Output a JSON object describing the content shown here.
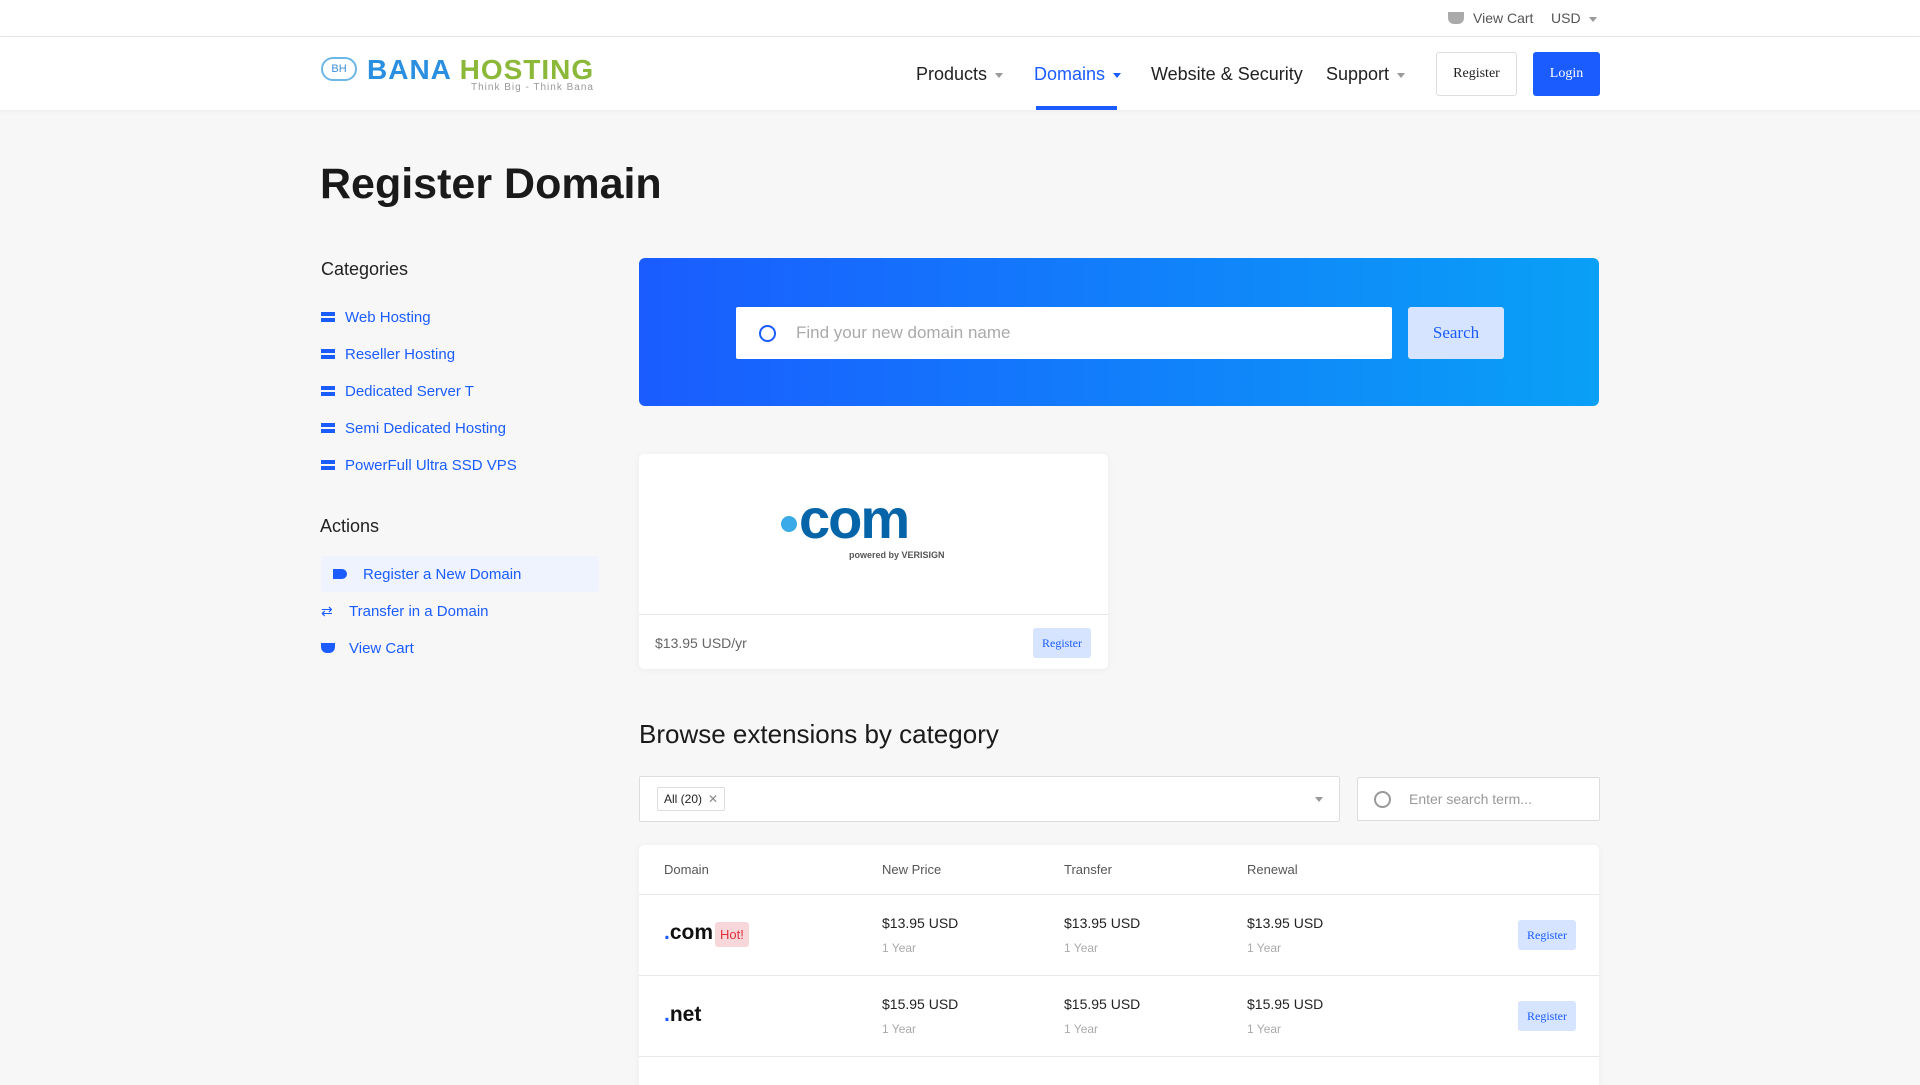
{
  "topbar": {
    "view_cart": "View Cart",
    "currency": "USD"
  },
  "brand": {
    "logo_main": "BANA",
    "logo_accent": "HOSTING",
    "tagline": "Think Big - Think Bana",
    "mark": "BH"
  },
  "nav": {
    "items": [
      {
        "label": "Products"
      },
      {
        "label": "Domains"
      },
      {
        "label": "Website & Security"
      },
      {
        "label": "Support"
      }
    ],
    "register": "Register",
    "login": "Login"
  },
  "page": {
    "title": "Register Domain"
  },
  "sidebar": {
    "categories_title": "Categories",
    "categories": [
      "Web Hosting",
      "Reseller Hosting",
      "Dedicated Server T",
      "Semi Dedicated Hosting",
      "PowerFull Ultra SSD VPS"
    ],
    "actions_title": "Actions",
    "actions": [
      "Register a New Domain",
      "Transfer in a Domain",
      "View Cart"
    ]
  },
  "search": {
    "placeholder": "Find your new domain name",
    "button": "Search"
  },
  "featured": {
    "logo_text": "com",
    "logo_sub": "powered by VERISIGN",
    "price": "$13.95 USD/yr",
    "register": "Register"
  },
  "browse": {
    "title": "Browse extensions by category",
    "filter_tag": "All (20)",
    "search_placeholder": "Enter search term..."
  },
  "table": {
    "headers": [
      "Domain",
      "New Price",
      "Transfer",
      "Renewal"
    ],
    "rows": [
      {
        "tld": "com",
        "badge": "Hot!",
        "new": "$13.95 USD",
        "transfer": "$13.95 USD",
        "renewal": "$13.95 USD",
        "period": "1 Year",
        "action": "Register"
      },
      {
        "tld": "net",
        "badge": "",
        "new": "$15.95 USD",
        "transfer": "$15.95 USD",
        "renewal": "$15.95 USD",
        "period": "1 Year",
        "action": "Register"
      }
    ]
  },
  "colors": {
    "accent": "#1a5cff",
    "hot": "#e0303a"
  }
}
